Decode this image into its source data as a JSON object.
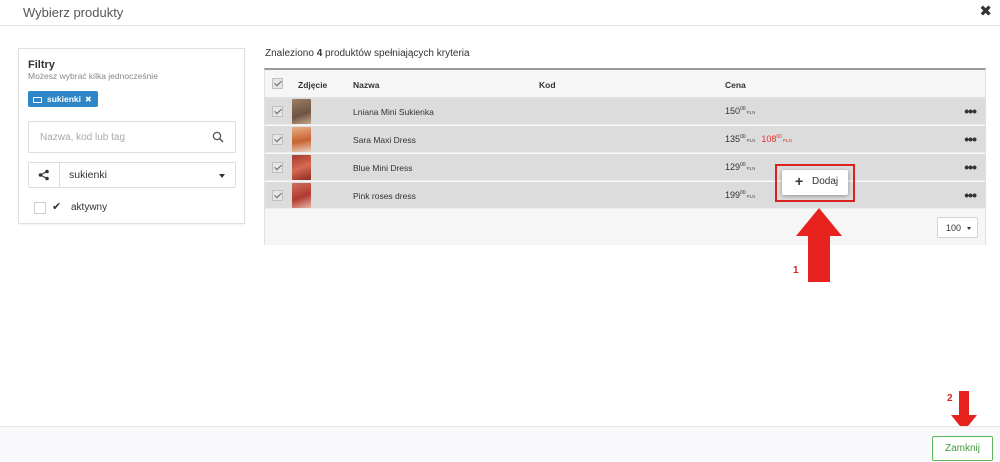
{
  "modal": {
    "title": "Wybierz produkty",
    "close_icon": "close-icon"
  },
  "filters": {
    "title": "Filtry",
    "subtitle": "Możesz wybrać kilka jednocześnie",
    "active_tag": "sukienki",
    "search_placeholder": "Nazwa, kod lub tag",
    "select_value": "sukienki",
    "active_label": "aktywny"
  },
  "results": {
    "found_prefix": "Znaleziono",
    "found_count": "4",
    "found_suffix": "produktów spełniających kryteria",
    "columns": {
      "photo": "Zdjęcie",
      "name": "Nazwa",
      "code": "Kod",
      "price": "Cena"
    },
    "rows": [
      {
        "name": "Lniana Mini Sukienka",
        "code": "",
        "price_int": "150",
        "price_dec": "00",
        "currency": "PLN",
        "sale_int": "",
        "sale_dec": "",
        "thumb_color": "#8a6f5a"
      },
      {
        "name": "Sara Maxi Dress",
        "code": "",
        "price_int": "135",
        "price_dec": "00",
        "currency": "PLN",
        "sale_int": "108",
        "sale_dec": "00",
        "thumb_color": "#c8734a"
      },
      {
        "name": "Blue Mini Dress",
        "code": "",
        "price_int": "129",
        "price_dec": "00",
        "currency": "PLN",
        "sale_int": "",
        "sale_dec": "",
        "thumb_color": "#b84a3a"
      },
      {
        "name": "Pink roses dress",
        "code": "",
        "price_int": "199",
        "price_dec": "00",
        "currency": "PLN",
        "sale_int": "",
        "sale_dec": "",
        "thumb_color": "#c24a3e"
      }
    ],
    "per_page": "100"
  },
  "tooltip": {
    "add_label": "Dodaj"
  },
  "annotations": {
    "step1": "1",
    "step2": "2",
    "color": "#d8231f"
  },
  "footer": {
    "close_label": "Zamknij"
  },
  "colors": {
    "tag_blue": "#2f86c6",
    "row_gray": "#dcdcdc",
    "sale_red": "#e0322d",
    "close_green": "#5cb85c"
  }
}
